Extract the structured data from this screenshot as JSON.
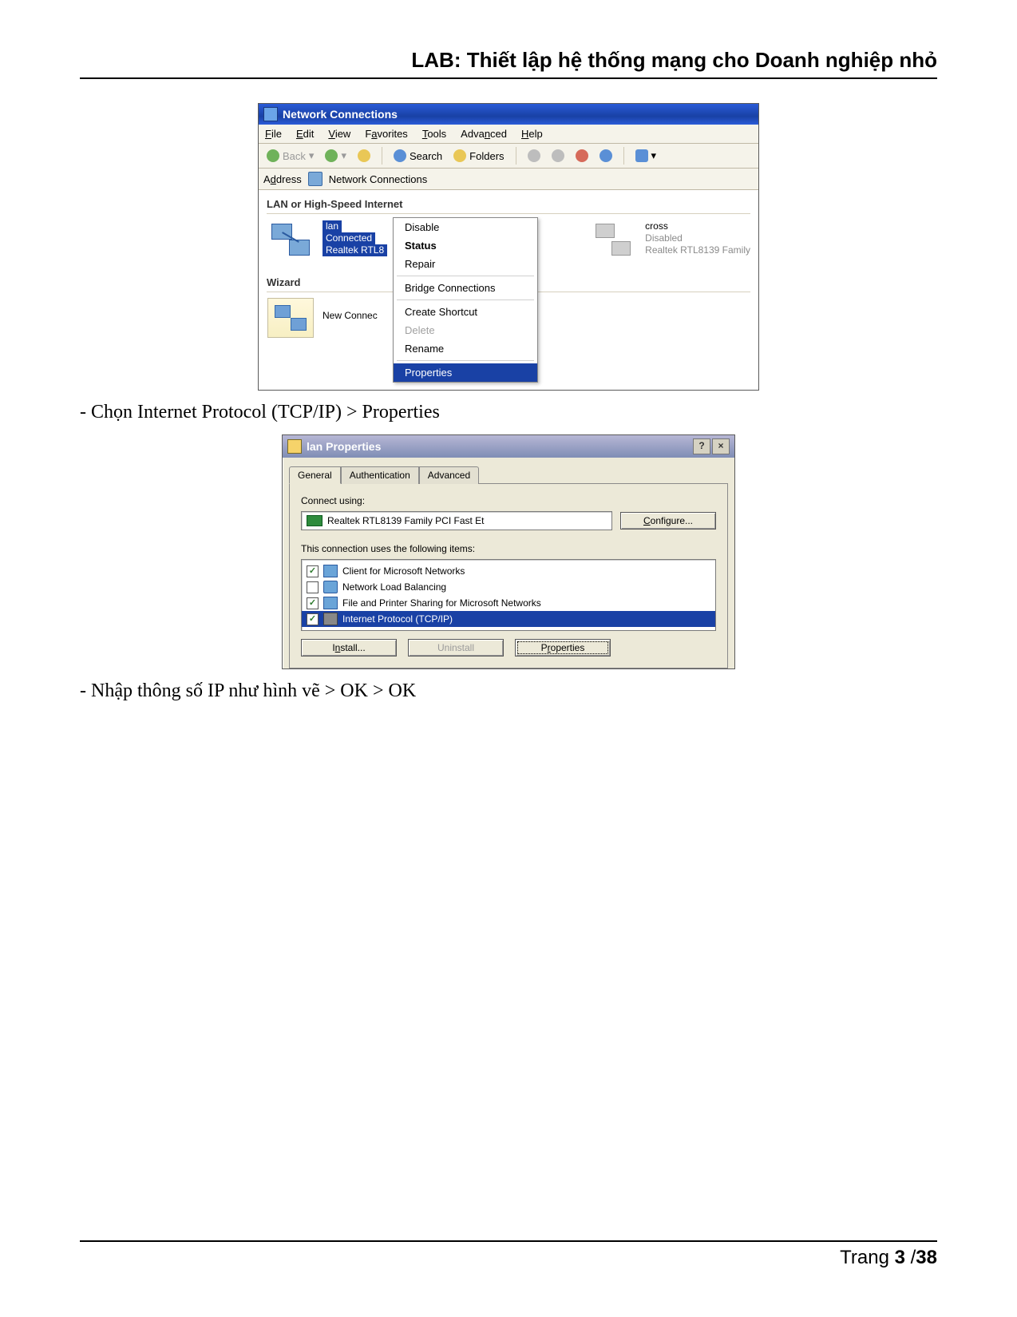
{
  "header": {
    "title": "LAB: Thiết lập hệ thống mạng cho Doanh nghiệp nhỏ"
  },
  "text": {
    "step2": "- Chọn Internet Protocol (TCP/IP) > Properties",
    "step3": "- Nhập thông số IP như hình vẽ > OK > OK"
  },
  "footer": {
    "label": "Trang",
    "page": "3",
    "sep": "/",
    "total": "38"
  },
  "win1": {
    "title": "Network Connections",
    "menu": {
      "file": "File",
      "edit": "Edit",
      "view": "View",
      "favorites": "Favorites",
      "tools": "Tools",
      "advanced": "Advanced",
      "help": "Help"
    },
    "toolbar": {
      "back": "Back",
      "search": "Search",
      "folders": "Folders"
    },
    "address": {
      "label": "Address",
      "value": "Network Connections"
    },
    "sections": {
      "lan": "LAN or High-Speed Internet",
      "wizard": "Wizard"
    },
    "conn_lan": {
      "name": "lan",
      "status": "Connected",
      "device": "Realtek RTL8"
    },
    "conn_cross": {
      "name": "cross",
      "status": "Disabled",
      "device": "Realtek RTL8139 Family"
    },
    "wizard_item": "New Connec",
    "context": {
      "disable": "Disable",
      "status": "Status",
      "repair": "Repair",
      "bridge": "Bridge Connections",
      "shortcut": "Create Shortcut",
      "delete": "Delete",
      "rename": "Rename",
      "properties": "Properties"
    }
  },
  "win2": {
    "title": "lan Properties",
    "help": "?",
    "close": "×",
    "tabs": {
      "general": "General",
      "auth": "Authentication",
      "advanced": "Advanced"
    },
    "connect_using": "Connect using:",
    "nic": "Realtek RTL8139 Family PCI Fast Et",
    "configure": "Configure...",
    "uses_label": "This connection uses the following items:",
    "items": {
      "client": "Client for Microsoft Networks",
      "nlb": "Network Load Balancing",
      "fps": "File and Printer Sharing for Microsoft Networks",
      "tcpip": "Internet Protocol (TCP/IP)"
    },
    "buttons": {
      "install": "Install...",
      "uninstall": "Uninstall",
      "properties": "Properties"
    }
  }
}
